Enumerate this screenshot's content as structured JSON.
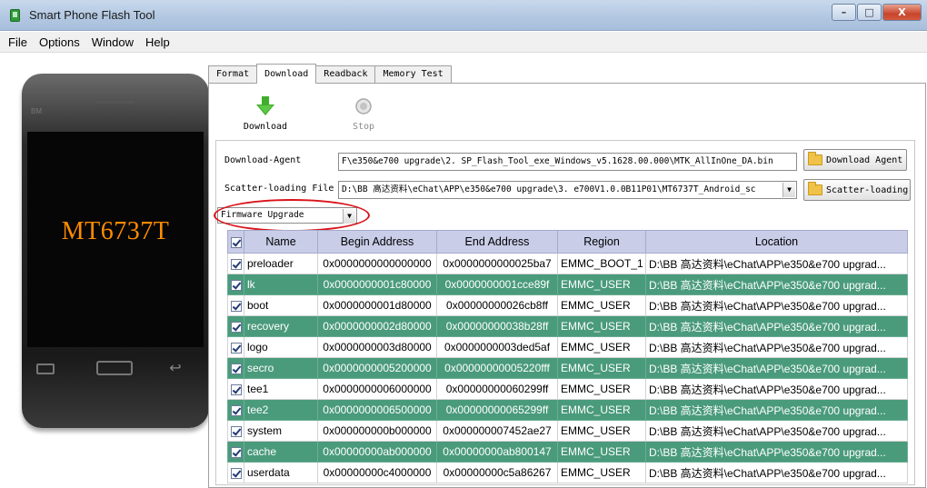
{
  "window": {
    "title": "Smart Phone Flash Tool",
    "minimize": "–",
    "maximize": "□",
    "close": "X"
  },
  "menu": [
    "File",
    "Options",
    "Window",
    "Help"
  ],
  "phone": {
    "brand": "BM",
    "model": "MT6737T"
  },
  "tabs": [
    "Format",
    "Download",
    "Readback",
    "Memory Test"
  ],
  "active_tab": "Download",
  "toolbar": {
    "download_label": "Download",
    "stop_label": "Stop"
  },
  "download_agent": {
    "label": "Download-Agent",
    "value": "F\\e350&e700 upgrade\\2. SP_Flash_Tool_exe_Windows_v5.1628.00.000\\MTK_AllInOne_DA.bin",
    "button": "Download Agent"
  },
  "scatter": {
    "label": "Scatter-loading File",
    "value": "D:\\BB 高达资料\\eChat\\APP\\e350&e700 upgrade\\3. e700V1.0.0B11P01\\MT6737T_Android_sc",
    "button": "Scatter-loading"
  },
  "mode": {
    "selected": "Firmware Upgrade"
  },
  "table": {
    "headers": [
      "Name",
      "Begin Address",
      "End Address",
      "Region",
      "Location"
    ],
    "rows": [
      {
        "name": "preloader",
        "begin": "0x0000000000000000",
        "end": "0x0000000000025ba7",
        "region": "EMMC_BOOT_1",
        "location": "D:\\BB 高达资料\\eChat\\APP\\e350&e700 upgrad..."
      },
      {
        "name": "lk",
        "begin": "0x0000000001c80000",
        "end": "0x0000000001cce89f",
        "region": "EMMC_USER",
        "location": "D:\\BB 高达资料\\eChat\\APP\\e350&e700 upgrad..."
      },
      {
        "name": "boot",
        "begin": "0x0000000001d80000",
        "end": "0x00000000026cb8ff",
        "region": "EMMC_USER",
        "location": "D:\\BB 高达资料\\eChat\\APP\\e350&e700 upgrad..."
      },
      {
        "name": "recovery",
        "begin": "0x0000000002d80000",
        "end": "0x00000000038b28ff",
        "region": "EMMC_USER",
        "location": "D:\\BB 高达资料\\eChat\\APP\\e350&e700 upgrad..."
      },
      {
        "name": "logo",
        "begin": "0x0000000003d80000",
        "end": "0x0000000003ded5af",
        "region": "EMMC_USER",
        "location": "D:\\BB 高达资料\\eChat\\APP\\e350&e700 upgrad..."
      },
      {
        "name": "secro",
        "begin": "0x0000000005200000",
        "end": "0x00000000005220fff",
        "region": "EMMC_USER",
        "location": "D:\\BB 高达资料\\eChat\\APP\\e350&e700 upgrad..."
      },
      {
        "name": "tee1",
        "begin": "0x0000000006000000",
        "end": "0x00000000060299ff",
        "region": "EMMC_USER",
        "location": "D:\\BB 高达资料\\eChat\\APP\\e350&e700 upgrad..."
      },
      {
        "name": "tee2",
        "begin": "0x0000000006500000",
        "end": "0x00000000065299ff",
        "region": "EMMC_USER",
        "location": "D:\\BB 高达资料\\eChat\\APP\\e350&e700 upgrad..."
      },
      {
        "name": "system",
        "begin": "0x000000000b000000",
        "end": "0x000000007452ae27",
        "region": "EMMC_USER",
        "location": "D:\\BB 高达资料\\eChat\\APP\\e350&e700 upgrad..."
      },
      {
        "name": "cache",
        "begin": "0x00000000ab000000",
        "end": "0x00000000ab800147",
        "region": "EMMC_USER",
        "location": "D:\\BB 高达资料\\eChat\\APP\\e350&e700 upgrad..."
      },
      {
        "name": "userdata",
        "begin": "0x00000000c4000000",
        "end": "0x00000000c5a86267",
        "region": "EMMC_USER",
        "location": "D:\\BB 高达资料\\eChat\\APP\\e350&e700 upgrad..."
      }
    ]
  },
  "colors": {
    "highlight_row": "#4a9b7b",
    "header_bg": "#c9cde8",
    "annotation": "#d8141a",
    "phone_model": "#ff8c00"
  }
}
